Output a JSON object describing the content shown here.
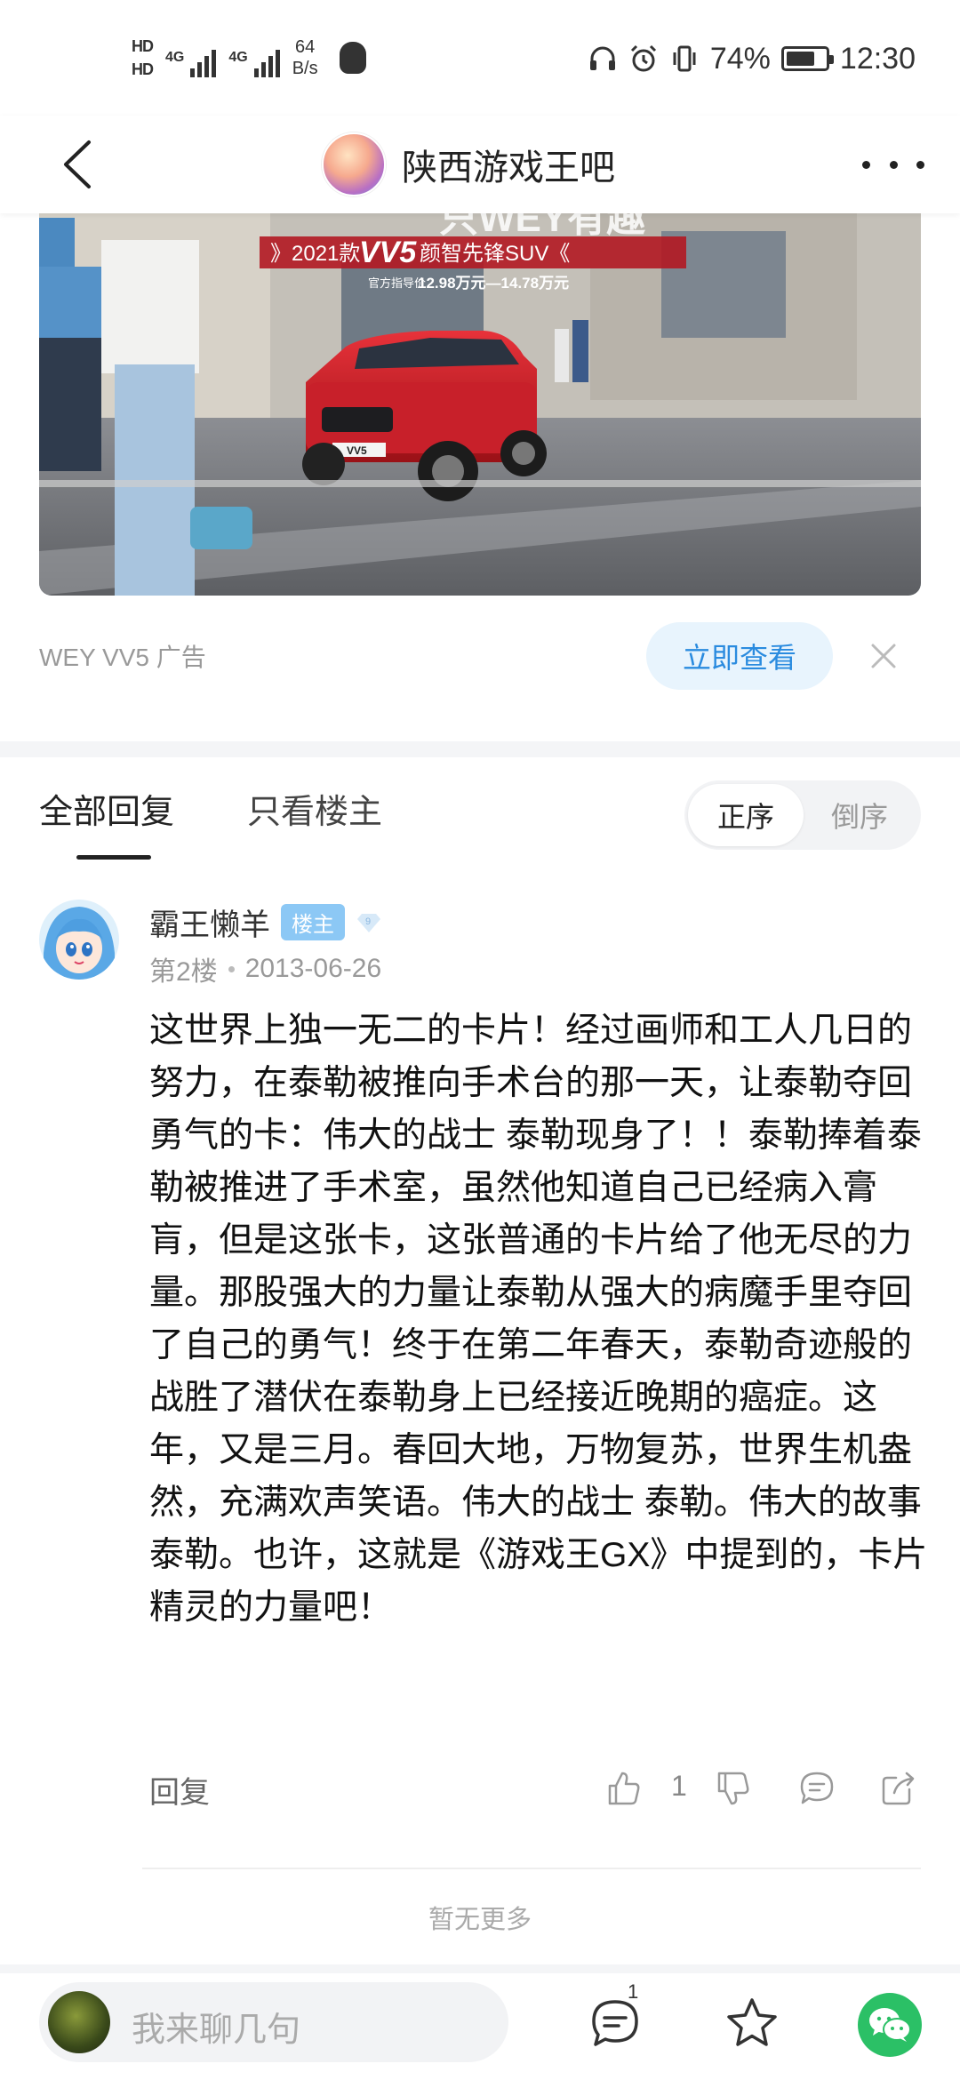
{
  "status_bar": {
    "hd1": "HD",
    "hd2": "HD",
    "net1": "4G",
    "net2": "4G",
    "speed_value": "64",
    "speed_unit": "B/s",
    "battery": "74%",
    "battery_level": 0.74,
    "time": "12:30"
  },
  "header": {
    "title": "陕西游戏王吧"
  },
  "ad": {
    "headline": "只WEY有趣",
    "year_model": "》2021款",
    "model": "VV5",
    "tagline": "颜智先锋SUV《",
    "price_label": "官方指导价",
    "price": "12.98万元—14.78万元",
    "plate": "VV5",
    "source": "WEY VV5  广告",
    "cta": "立即查看"
  },
  "tabs": {
    "all": "全部回复",
    "owner_only": "只看楼主",
    "order_asc": "正序",
    "order_desc": "倒序"
  },
  "post": {
    "author": "霸王懒羊",
    "owner_badge": "楼主",
    "level": "9",
    "floor": "第2楼",
    "date": "2013-06-26",
    "content": "这世界上独一无二的卡片！经过画师和工人几日的努力，在泰勒被推向手术台的那一天，让泰勒夺回勇气的卡：伟大的战士 泰勒现身了！！泰勒捧着泰勒被推进了手术室，虽然他知道自己已经病入膏肓，但是这张卡，这张普通的卡片给了他无尽的力量。那股强大的力量让泰勒从强大的病魔手里夺回了自己的勇气！终于在第二年春天，泰勒奇迹般的战胜了潜伏在泰勒身上已经接近晚期的癌症。这年，又是三月。春回大地，万物复苏，世界生机盎然，充满欢声笑语。伟大的战士 泰勒。伟大的故事 泰勒。也许，这就是《游戏王GX》中提到的，卡片精灵的力量吧！",
    "reply_label": "回复",
    "like_count": "1"
  },
  "footer": {
    "no_more": "暂无更多"
  },
  "bottom_bar": {
    "input_placeholder": "我来聊几句",
    "comment_count": "1"
  },
  "colors": {
    "accent_blue": "#2a8bdf",
    "cta_bg": "#e8f4fd",
    "owner_badge": "#8cc8f5",
    "wechat_green": "#2bc066"
  },
  "icons": [
    "back-icon",
    "more-icon",
    "close-icon",
    "thumb-up-icon",
    "thumb-down-icon",
    "comment-icon",
    "share-icon",
    "comments-icon",
    "star-icon",
    "wechat-icon"
  ]
}
